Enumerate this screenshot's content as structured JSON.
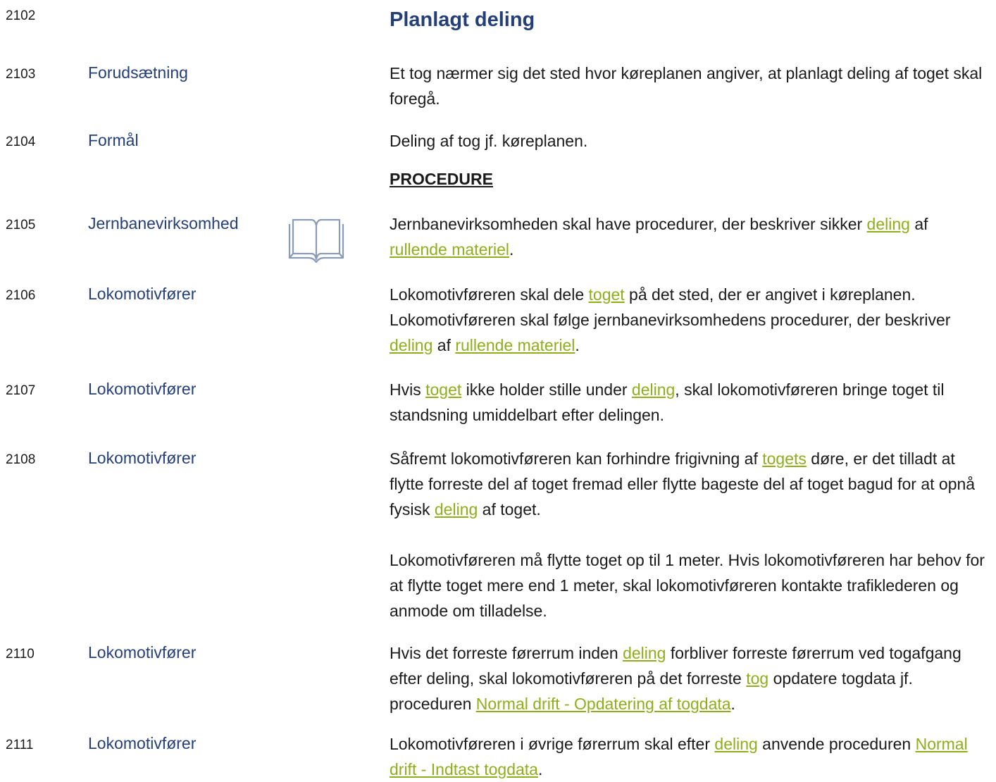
{
  "title": {
    "number": "2102",
    "text": "Planlagt deling"
  },
  "section_heading": "PROCEDURE",
  "rows": [
    {
      "number": "2103",
      "role": "Forudsætning",
      "text": "Et tog nærmer sig det sted hvor køreplanen angiver, at planlagt deling af toget skal foregå."
    },
    {
      "number": "2104",
      "role": "Formål",
      "text": "Deling af tog jf. køreplanen."
    },
    {
      "number": "2105",
      "role": "Jernbanevirksomhed",
      "seg": [
        "Jernbanevirksomheden skal have procedurer, der beskriver sikker ",
        "deling",
        " af ",
        "rullende materiel",
        "."
      ]
    },
    {
      "number": "2106",
      "role": "Lokomotivfører",
      "seg": [
        "Lokomotivføreren skal dele ",
        "toget",
        " på det sted, der er angivet i køreplanen. Lokomotivføreren skal følge jernbanevirksomhedens procedurer, der beskriver ",
        "deling",
        " af ",
        "rullende materiel",
        "."
      ]
    },
    {
      "number": "2107",
      "role": "Lokomotivfører",
      "seg": [
        "Hvis ",
        "toget",
        " ikke holder stille under ",
        "deling",
        ", skal lokomotivføreren bringe toget til standsning umiddelbart efter delingen."
      ]
    },
    {
      "number": "2108",
      "role": "Lokomotivfører",
      "seg": [
        "Såfremt lokomotivføreren kan forhindre frigivning af ",
        "togets",
        " døre, er det tilladt at flytte forreste del af toget fremad eller flytte bageste del af toget bagud for at opnå fysisk ",
        "deling",
        " af toget."
      ],
      "text2": "Lokomotivføreren må flytte toget op til 1 meter. Hvis lokomotivføreren har behov for at flytte toget mere end 1 meter, skal lokomotivføreren kontakte trafiklederen og anmode om tilladelse."
    },
    {
      "number": "2110",
      "role": "Lokomotivfører",
      "seg": [
        "Hvis det forreste førerrum inden ",
        "deling",
        " forbliver forreste førerrum ved togafgang efter deling, skal lokomotivføreren på det forreste ",
        "tog",
        " opdatere togdata jf. proceduren ",
        "Normal drift - Opdatering af togdata",
        "."
      ]
    },
    {
      "number": "2111",
      "role": "Lokomotivfører",
      "seg": [
        "Lokomotivføreren i øvrige førerrum skal efter ",
        "deling",
        " anvende proceduren ",
        "Normal drift - Indtast togdata",
        "."
      ]
    }
  ]
}
